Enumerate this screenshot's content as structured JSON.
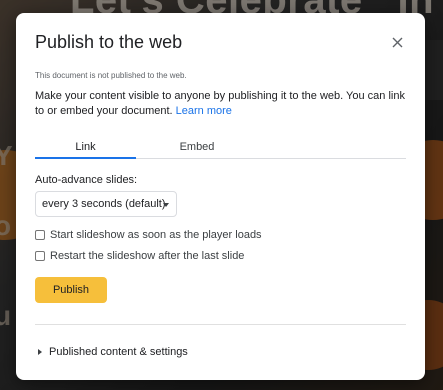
{
  "background": {
    "title_text": "Let's Celebrate",
    "title_text_right": "In"
  },
  "dialog": {
    "title": "Publish to the web",
    "close_icon": "close-icon",
    "status": "This document is not published to the web.",
    "description": "Make your content visible to anyone by publishing it to the web. You can link to or embed your document.",
    "learn_more": "Learn more",
    "tabs": [
      {
        "label": "Link",
        "active": true
      },
      {
        "label": "Embed",
        "active": false
      }
    ],
    "auto_advance": {
      "label": "Auto-advance slides:",
      "selected": "every 3 seconds (default)"
    },
    "options": [
      {
        "label": "Start slideshow as soon as the player loads",
        "checked": false
      },
      {
        "label": "Restart the slideshow after the last slide",
        "checked": false
      }
    ],
    "publish_label": "Publish",
    "publish_color": "#f6bf3b",
    "accent_color": "#1a73e8",
    "expander_label": "Published content & settings"
  }
}
